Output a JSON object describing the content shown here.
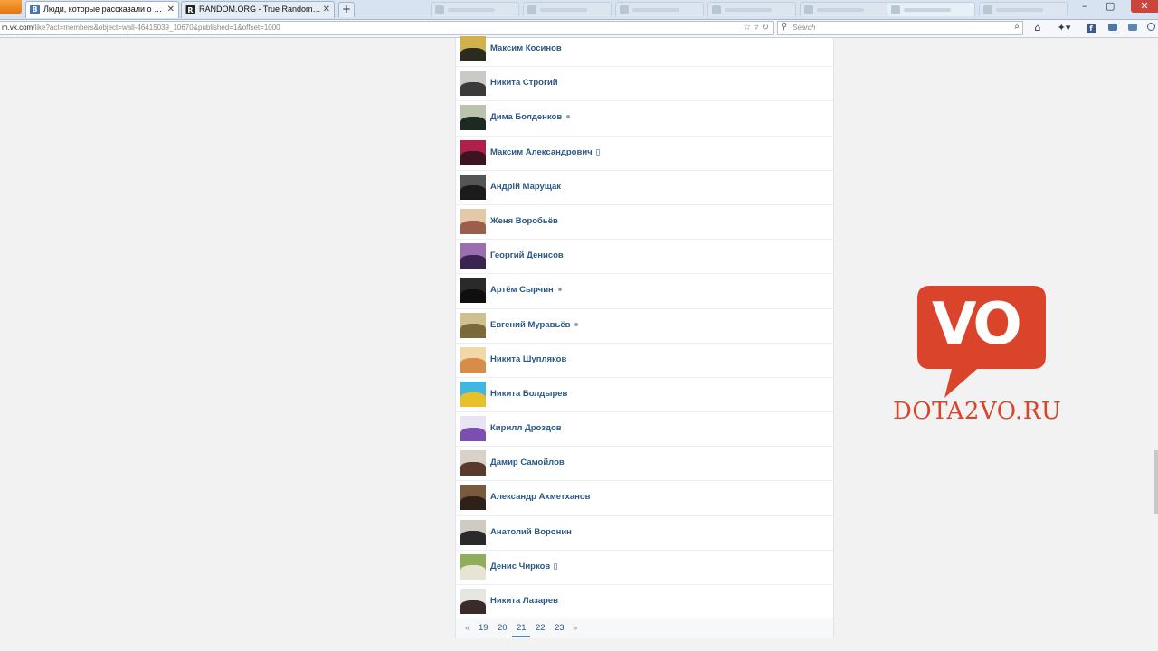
{
  "browser": {
    "tabs": [
      {
        "title": "Люди, которые рассказали о запис...",
        "favicon": "vk-favicon",
        "active": true
      },
      {
        "title": "RANDOM.ORG - True Random Num...",
        "favicon": "random-org-favicon",
        "active": false
      }
    ],
    "new_tab": "+",
    "url": {
      "host": "m.vk.com",
      "rest": "/like?act=members&object=wall-46415039_10670&published=1&offset=1000"
    },
    "search_placeholder": "Search",
    "window_controls": {
      "minimize": "–",
      "maximize": "▢",
      "close": "✕"
    }
  },
  "members": [
    {
      "name": "Максим Косинов",
      "status": "",
      "avatar": [
        "#d2b04a",
        "#2b2b20"
      ]
    },
    {
      "name": "Никита Строгий",
      "status": "",
      "avatar": [
        "#c9cac6",
        "#3a3a3a"
      ]
    },
    {
      "name": "Дима Болденков",
      "status": "online",
      "avatar": [
        "#b9c3ad",
        "#1d2a22"
      ]
    },
    {
      "name": "Максим Александрович",
      "status": "mobile",
      "avatar": [
        "#b0204a",
        "#3a1420"
      ]
    },
    {
      "name": "Андрій Марущак",
      "status": "",
      "avatar": [
        "#555555",
        "#1b1b1b"
      ]
    },
    {
      "name": "Женя Воробьёв",
      "status": "",
      "avatar": [
        "#e4c9a9",
        "#9b5e4a"
      ]
    },
    {
      "name": "Георгий Денисов",
      "status": "",
      "avatar": [
        "#9a6fb0",
        "#3b2450"
      ]
    },
    {
      "name": "Артём Сырчин",
      "status": "online",
      "avatar": [
        "#2a2a2a",
        "#0f0f0f"
      ]
    },
    {
      "name": "Евгений Муравьёв",
      "status": "online",
      "avatar": [
        "#cfc08f",
        "#7a6a3a"
      ]
    },
    {
      "name": "Никита Шупляков",
      "status": "",
      "avatar": [
        "#f1d8a6",
        "#d98b4a"
      ]
    },
    {
      "name": "Никита Болдырев",
      "status": "",
      "avatar": [
        "#3fb7e0",
        "#e8c02a"
      ]
    },
    {
      "name": "Кирилл Дроздов",
      "status": "",
      "avatar": [
        "#e9e4f4",
        "#7a4fb0"
      ]
    },
    {
      "name": "Дамир Самойлов",
      "status": "",
      "avatar": [
        "#d9d2c8",
        "#5a3a2a"
      ]
    },
    {
      "name": "Александр Ахметханов",
      "status": "",
      "avatar": [
        "#7a5a3e",
        "#2e2218"
      ]
    },
    {
      "name": "Анатолий Воронин",
      "status": "",
      "avatar": [
        "#cfcac2",
        "#2a2a2a"
      ]
    },
    {
      "name": "Денис Чирков",
      "status": "mobile",
      "avatar": [
        "#8fae5a",
        "#e8e4d4"
      ]
    },
    {
      "name": "Никита Лазарев",
      "status": "",
      "avatar": [
        "#e8e6e2",
        "#3a2a2a"
      ]
    }
  ],
  "pager": {
    "prev": "«",
    "pages": [
      "19",
      "20",
      "21",
      "22",
      "23"
    ],
    "current": "21",
    "next": "»"
  },
  "watermark": {
    "logo_text": "VO",
    "site": "DOTA2VO.RU",
    "color": "#d9442b"
  }
}
